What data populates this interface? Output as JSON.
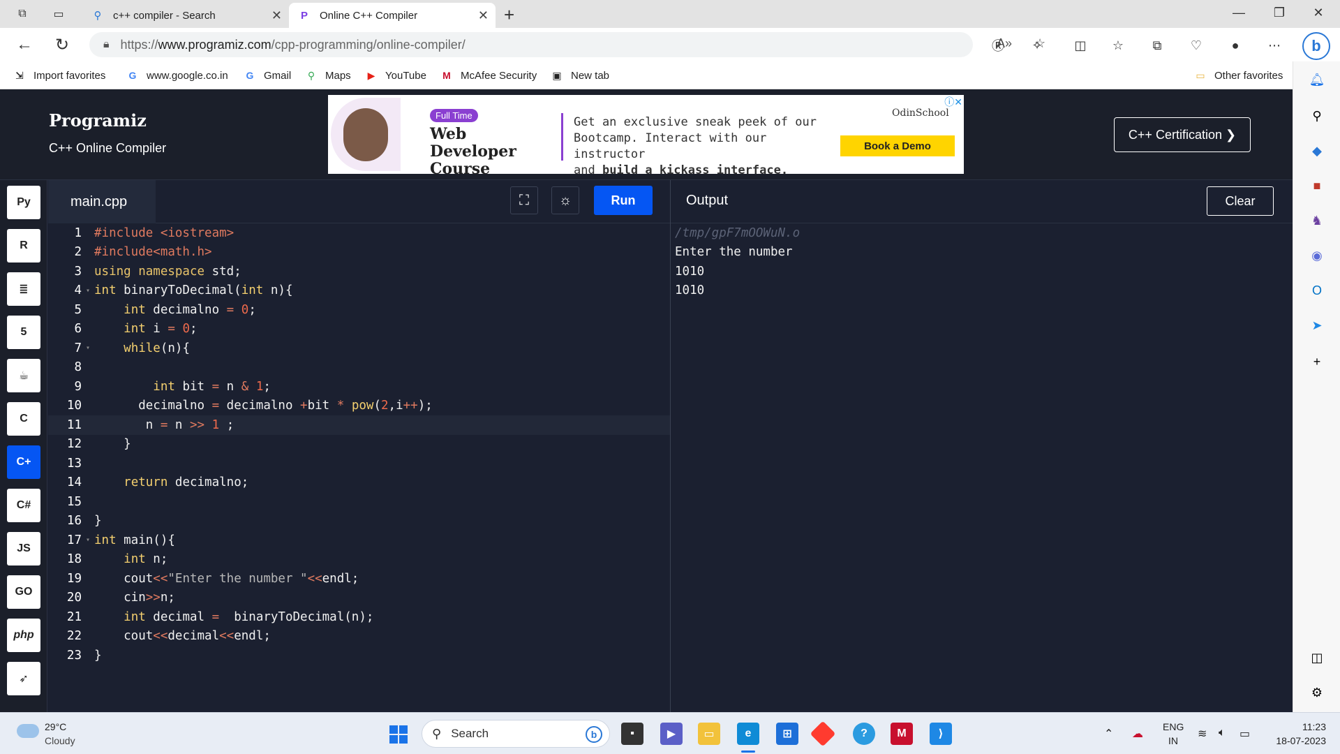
{
  "browser": {
    "tabs": [
      {
        "label": "c++ compiler - Search",
        "active": false
      },
      {
        "label": "Online C++ Compiler",
        "active": true
      }
    ],
    "url_prefix": "https://",
    "url_domain": "www.programiz.com",
    "url_path": "/cpp-programming/online-compiler/",
    "favorites": [
      {
        "label": "Import favorites",
        "icon": "import-icon"
      },
      {
        "label": "www.google.co.in",
        "icon": "google-icon"
      },
      {
        "label": "Gmail",
        "icon": "google-icon"
      },
      {
        "label": "Maps",
        "icon": "maps-icon"
      },
      {
        "label": "YouTube",
        "icon": "youtube-icon"
      },
      {
        "label": "McAfee Security",
        "icon": "mcafee-icon"
      },
      {
        "label": "New tab",
        "icon": "newtab-icon"
      }
    ],
    "other_favorites": "Other favorites"
  },
  "header": {
    "logo": "Programiz",
    "subtitle": "C++ Online Compiler",
    "certification_button": "C++ Certification ❯"
  },
  "ad": {
    "badge": "Full Time",
    "title": "Web Developer Course",
    "text_line1": "Get an exclusive sneak peek of our",
    "text_line2": "Bootcamp. Interact with our instructor",
    "text_line3_pre": "and ",
    "text_line3_bold": "build a kickass interface.",
    "brand": "OdinSchool",
    "cta": "Book a Demo"
  },
  "editor": {
    "filename": "main.cpp",
    "run_label": "Run",
    "line_numbers": [
      "1",
      "2",
      "3",
      "4",
      "5",
      "6",
      "7",
      "8",
      "9",
      "10",
      "11",
      "12",
      "13",
      "14",
      "15",
      "16",
      "17",
      "18",
      "19",
      "20",
      "21",
      "22",
      "23"
    ]
  },
  "output": {
    "title": "Output",
    "clear_label": "Clear",
    "lines": [
      "/tmp/gpF7mOOWuN.o",
      "Enter the number",
      "1010",
      "1010"
    ]
  },
  "taskbar": {
    "temperature": "29°C",
    "condition": "Cloudy",
    "search_placeholder": "Search",
    "lang": "ENG",
    "region": "IN",
    "time": "11:23",
    "date": "18-07-2023"
  },
  "colors": {
    "run_button": "#0556f3",
    "editor_bg": "#1b2030",
    "keyword": "#f4d06f",
    "number": "#ee6a4c"
  }
}
